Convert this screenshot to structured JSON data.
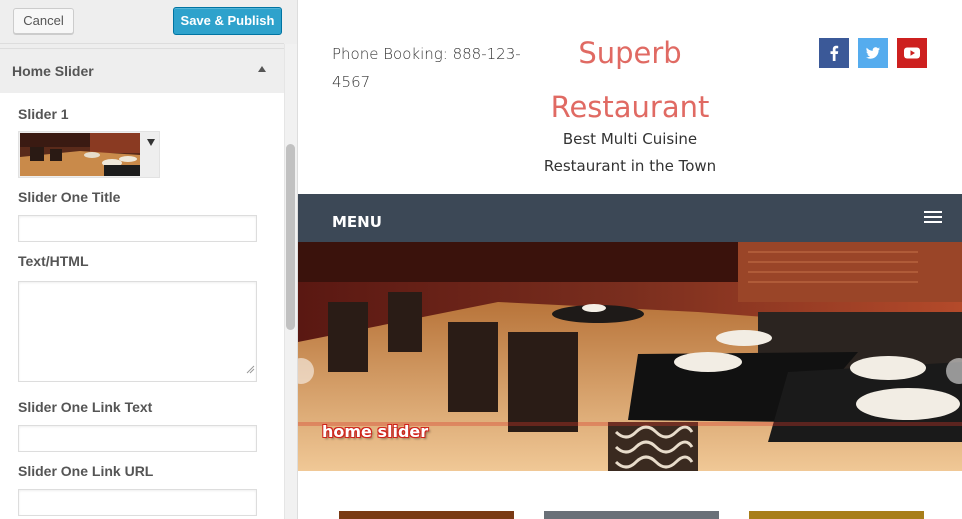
{
  "header": {
    "cancel_label": "Cancel",
    "publish_label": "Save & Publish"
  },
  "section": {
    "title": "Home Slider"
  },
  "fields": {
    "slider1_label": "Slider 1",
    "title_label": "Slider One Title",
    "title_value": "",
    "text_label": "Text/HTML",
    "text_value": "",
    "link_text_label": "Slider One Link Text",
    "link_text_value": "",
    "link_url_label": "Slider One Link URL",
    "link_url_value": ""
  },
  "preview": {
    "phone": "Phone Booking: 888-123-4567",
    "site_title": "Superb Restaurant",
    "tagline": "Best Multi Cuisine Restaurant in the Town",
    "menu_label": "MENU",
    "slide_caption": "home slider",
    "social_icons": [
      "facebook-icon",
      "twitter-icon",
      "youtube-icon"
    ]
  },
  "colors": {
    "publish_button": "#2ea2cc",
    "site_title": "#e06a63",
    "navbar": "#3c4856",
    "facebook": "#3b5998",
    "twitter": "#55acee",
    "youtube": "#cd201f"
  }
}
